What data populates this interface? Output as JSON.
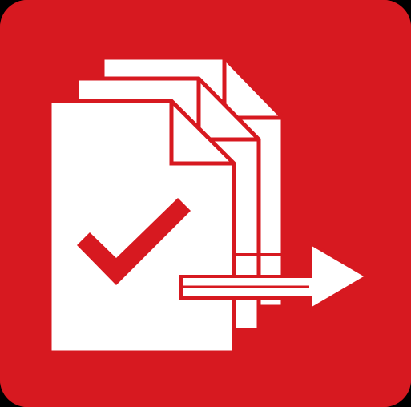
{
  "app_icon": {
    "icon_name": "batch-documents-approve-export-icon",
    "background_color": "#d71920",
    "paper_color": "#ffffff",
    "outline_color": "#d71920"
  },
  "documents": {
    "count": 3,
    "icon_name": "document-stack-icon"
  },
  "checkmark": {
    "icon_name": "checkmark-icon",
    "color": "#d71920"
  },
  "arrow": {
    "icon_name": "right-arrow-icon",
    "direction": "right"
  }
}
